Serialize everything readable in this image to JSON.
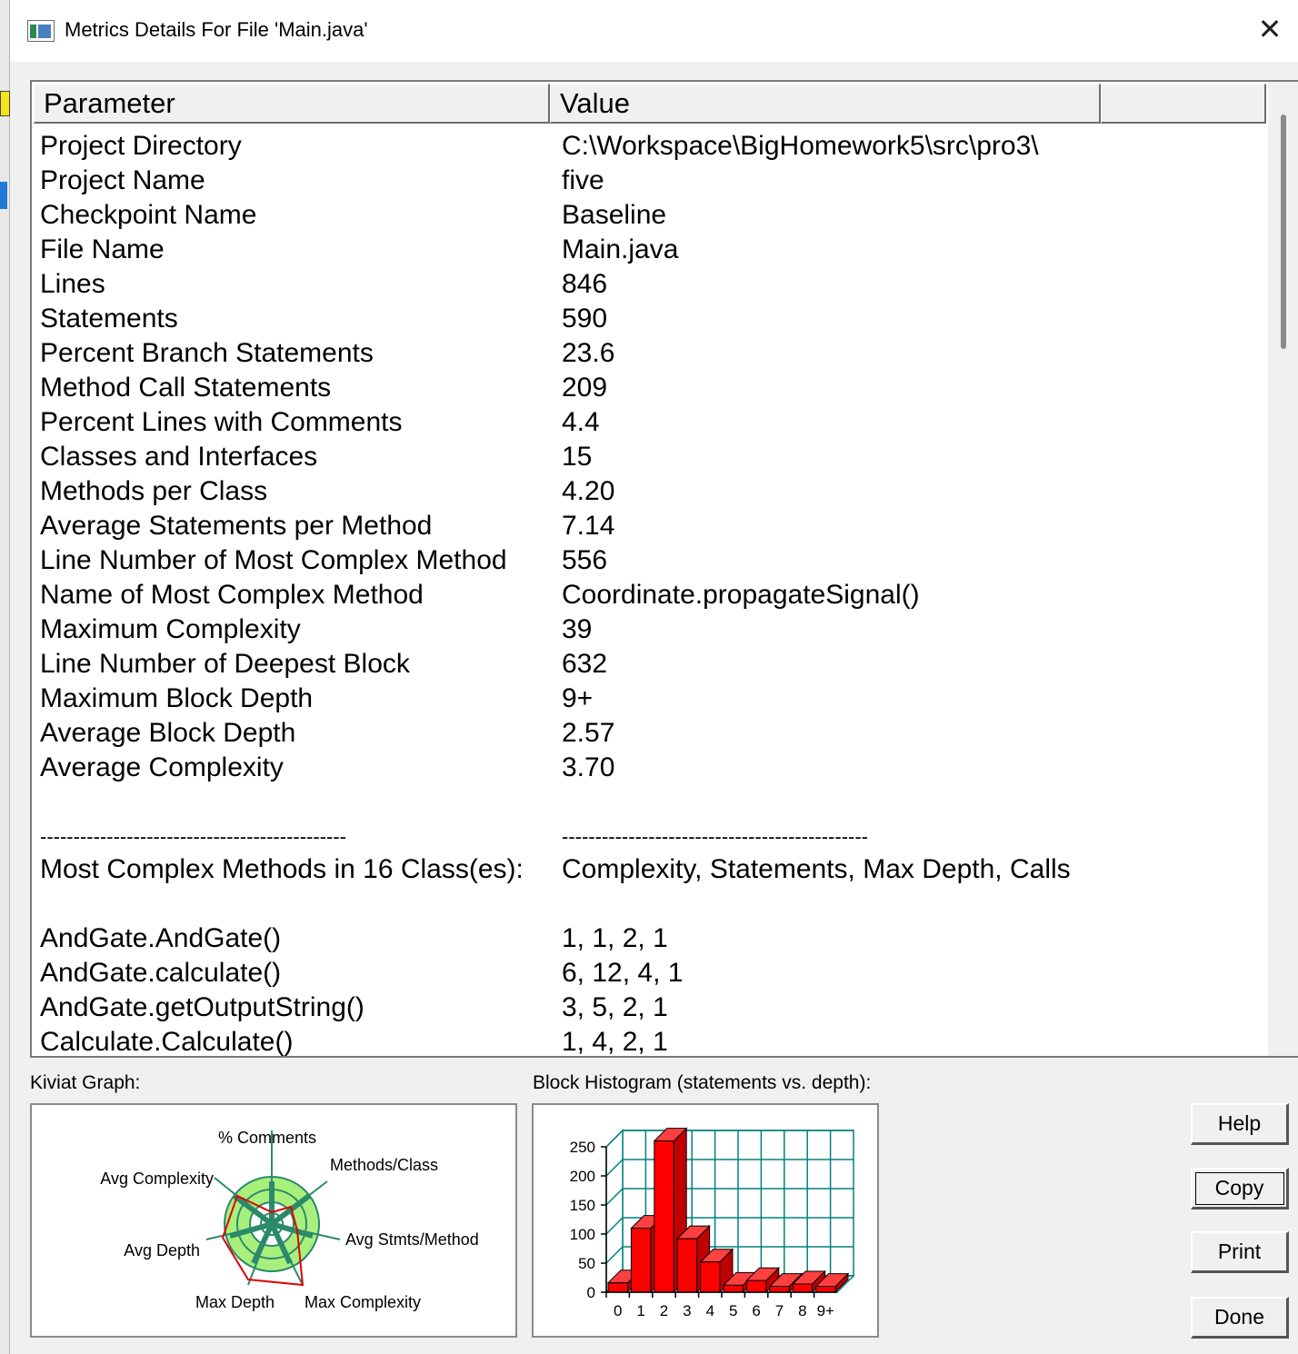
{
  "window": {
    "title": "Metrics Details For File 'Main.java'",
    "close_glyph": "✕"
  },
  "table": {
    "headers": {
      "parameter": "Parameter",
      "value": "Value"
    },
    "rows": [
      {
        "p": "Project Directory",
        "v": "C:\\Workspace\\BigHomework5\\src\\pro3\\"
      },
      {
        "p": "Project Name",
        "v": "five"
      },
      {
        "p": "Checkpoint Name",
        "v": "Baseline"
      },
      {
        "p": "File Name",
        "v": "Main.java"
      },
      {
        "p": "Lines",
        "v": "846"
      },
      {
        "p": "Statements",
        "v": "590"
      },
      {
        "p": "Percent Branch Statements",
        "v": "23.6"
      },
      {
        "p": "Method Call Statements",
        "v": "209"
      },
      {
        "p": "Percent Lines with Comments",
        "v": "4.4"
      },
      {
        "p": "Classes and Interfaces",
        "v": "15"
      },
      {
        "p": "Methods per Class",
        "v": "4.20"
      },
      {
        "p": "Average Statements per Method",
        "v": "7.14"
      },
      {
        "p": "Line Number of Most Complex Method",
        "v": "556"
      },
      {
        "p": "Name of Most Complex Method",
        "v": "Coordinate.propagateSignal()"
      },
      {
        "p": "Maximum Complexity",
        "v": "39"
      },
      {
        "p": "Line Number of Deepest Block",
        "v": "632"
      },
      {
        "p": "Maximum Block Depth",
        "v": "9+"
      },
      {
        "p": "Average Block Depth",
        "v": "2.57"
      },
      {
        "p": "Average Complexity",
        "v": "3.70"
      }
    ],
    "separator": {
      "p": "----------------------------------------------",
      "v": "----------------------------------------------"
    },
    "methods_header": {
      "p": "Most Complex Methods in 16 Class(es):",
      "v": "Complexity, Statements, Max Depth, Calls"
    },
    "methods": [
      {
        "p": "AndGate.AndGate()",
        "v": "1, 1, 2, 1"
      },
      {
        "p": "AndGate.calculate()",
        "v": "6, 12, 4, 1"
      },
      {
        "p": "AndGate.getOutputString()",
        "v": "3, 5, 2, 1"
      },
      {
        "p": "Calculate.Calculate()",
        "v": "1, 4, 2, 1"
      }
    ]
  },
  "kiviat": {
    "label": "Kiviat Graph:",
    "axes": [
      "% Comments",
      "Methods/Class",
      "Avg Stmts/Method",
      "Max Complexity",
      "Max Depth",
      "Avg Depth",
      "Avg Complexity"
    ]
  },
  "histogram": {
    "label": "Block Histogram (statements vs. depth):",
    "y_ticks": [
      "0",
      "50",
      "100",
      "150",
      "200",
      "250"
    ],
    "chart_data": {
      "type": "bar",
      "categories": [
        "0",
        "1",
        "2",
        "3",
        "4",
        "5",
        "6",
        "7",
        "8",
        "9+"
      ],
      "values": [
        16,
        110,
        260,
        92,
        52,
        12,
        20,
        10,
        14,
        10
      ],
      "ylim": [
        0,
        250
      ],
      "bar_color": "#ff0000",
      "grid_color": "#008080"
    }
  },
  "buttons": {
    "help": "Help",
    "copy": "Copy",
    "print": "Print",
    "done": "Done"
  }
}
